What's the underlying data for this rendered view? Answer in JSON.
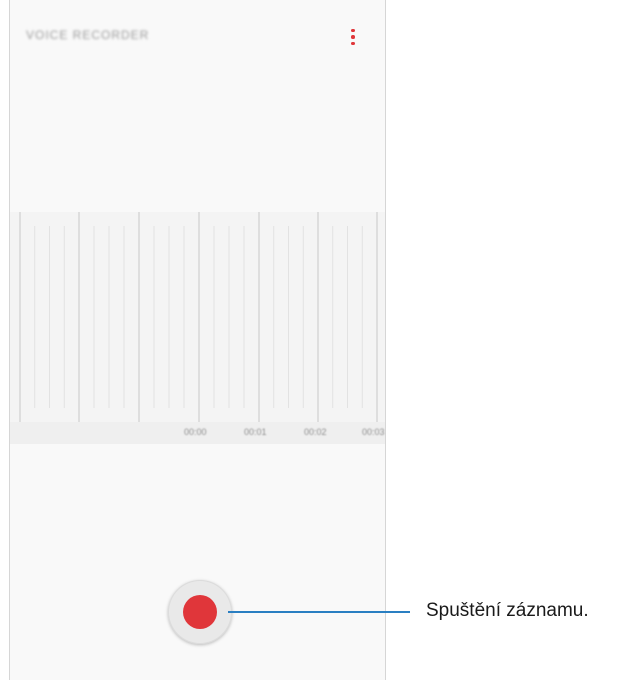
{
  "app": {
    "title": "VOICE RECORDER",
    "more_icon": "more-vertical-icon"
  },
  "timeline": {
    "labels": [
      "00:00",
      "00:01",
      "00:02",
      "00:03"
    ]
  },
  "record": {
    "icon": "record-icon",
    "color": "#e0363a"
  },
  "callout": {
    "text": "Spuštění záznamu.",
    "line_color": "#2a7fc2"
  }
}
